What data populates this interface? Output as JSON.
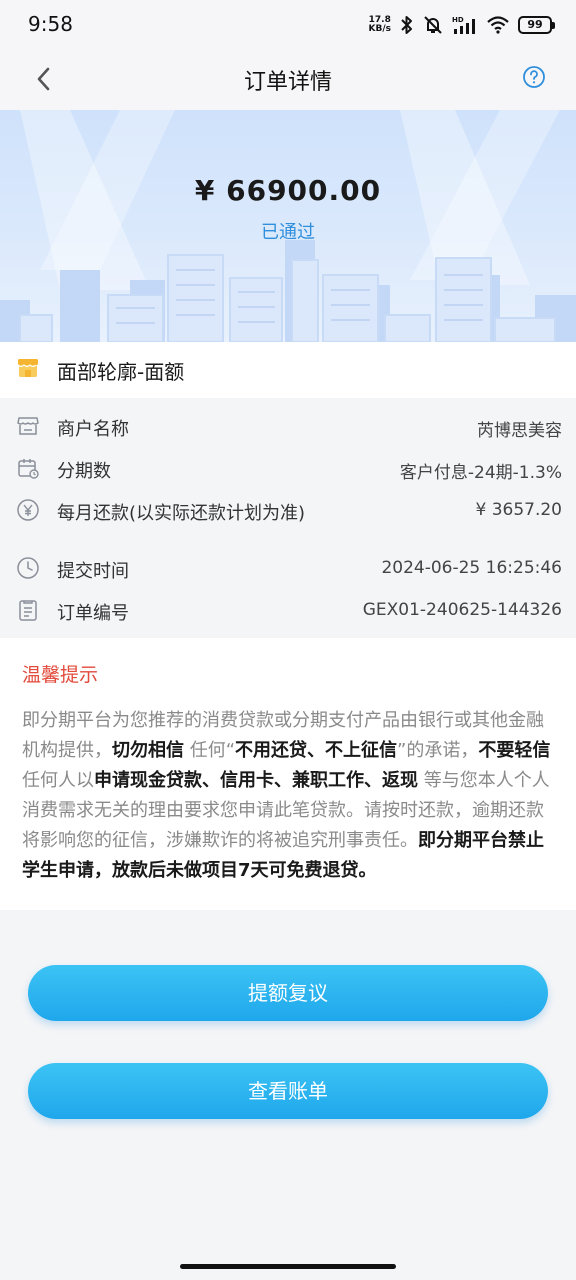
{
  "status_bar": {
    "time": "9:58",
    "net_speed_value": "17.8",
    "net_speed_unit": "KB/s",
    "battery": "99",
    "icons": [
      "bluetooth-icon",
      "mute-bell-icon",
      "hd-signal-icon",
      "wifi-icon",
      "battery-icon"
    ]
  },
  "nav": {
    "title": "订单详情",
    "back_icon": "chevron-left-icon",
    "help_icon": "question-circle-icon"
  },
  "hero": {
    "amount": "¥ 66900.00",
    "status": "已通过"
  },
  "product": {
    "icon": "shop-icon",
    "name": "面部轮廓-面额"
  },
  "details": [
    {
      "icon": "store-icon",
      "label": "商户名称",
      "value": "芮博思美容"
    },
    {
      "icon": "calendar-icon",
      "label": "分期数",
      "value": "客户付息-24期-1.3%"
    },
    {
      "icon": "yen-circle-icon",
      "label": "每月还款(以实际还款计划为准)",
      "value": "¥ 3657.20"
    }
  ],
  "order_info": [
    {
      "icon": "clock-icon",
      "label": "提交时间",
      "value": "2024-06-25 16:25:46"
    },
    {
      "icon": "document-icon",
      "label": "订单编号",
      "value": "GEX01-240625-144326"
    }
  ],
  "notice": {
    "title": "温馨提示",
    "segments": [
      {
        "text": "即分期平台为您推荐的消费贷款或分期支付产品由银行或其他金融机构提供，",
        "bold": false
      },
      {
        "text": "切勿相信",
        "bold": true
      },
      {
        "text": " 任何“",
        "bold": false
      },
      {
        "text": "不用还贷、不上征信",
        "bold": true
      },
      {
        "text": "”的承诺，",
        "bold": false
      },
      {
        "text": "不要轻信",
        "bold": true
      },
      {
        "text": "任何人以",
        "bold": false
      },
      {
        "text": "申请现金贷款、信用卡、兼职工作、返现",
        "bold": true
      },
      {
        "text": " 等与您本人个人消费需求无关的理由要求您申请此笔贷款。请按时还款，逾期还款将影响您的征信，涉嫌欺诈的将被追究刑事责任。",
        "bold": false
      },
      {
        "text": "即分期平台禁止学生申请，放款后未做项目7天可免费退贷。",
        "bold": true
      }
    ]
  },
  "buttons": {
    "review": "提额复议",
    "bill": "查看账单"
  },
  "colors": {
    "accent": "#1fa7ec",
    "status_blue": "#2f8fdc",
    "notice_red": "#e24a3b"
  }
}
